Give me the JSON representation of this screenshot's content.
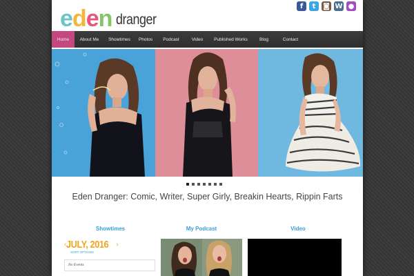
{
  "logo": {
    "letters": [
      "e",
      "d",
      "e",
      "n"
    ],
    "letter_colors": [
      "#6cc3c8",
      "#f3b63a",
      "#e7567c",
      "#86c46a"
    ],
    "word2": "dranger"
  },
  "social": [
    {
      "name": "facebook-icon",
      "glyph": "f",
      "color": "#3b5998"
    },
    {
      "name": "twitter-icon",
      "glyph": "t",
      "color": "#3aa7e0"
    },
    {
      "name": "instagram-icon",
      "glyph": "◙",
      "color": "#7a5c45"
    },
    {
      "name": "wordpress-icon",
      "glyph": "W",
      "color": "#4a6f8f"
    },
    {
      "name": "podcast-icon",
      "glyph": "●",
      "color": "#a04ec0"
    }
  ],
  "nav": {
    "items": [
      {
        "label": "Home"
      },
      {
        "label": "About Me"
      },
      {
        "label": "Showtimes"
      },
      {
        "label": "Photos"
      },
      {
        "label": "Podcast"
      },
      {
        "label": "Video"
      },
      {
        "label": "Published Works"
      },
      {
        "label": "Blog"
      },
      {
        "label": "Contact"
      }
    ],
    "active_index": 0
  },
  "slider": {
    "dot_count": 7,
    "active_dot": 0
  },
  "tagline": "Eden Dranger: Comic, Writer, Super Girly, Breakin Hearts, Rippin Farts",
  "columns": {
    "showtimes_title": "Showtimes",
    "podcast_title": "My Podcast",
    "video_title": "Video"
  },
  "calendar": {
    "prev_arrow": "‹",
    "month": "JULY, 2016",
    "next_arrow": "›",
    "sort_label": "SORT OPTIONS",
    "no_events": "No Events"
  }
}
